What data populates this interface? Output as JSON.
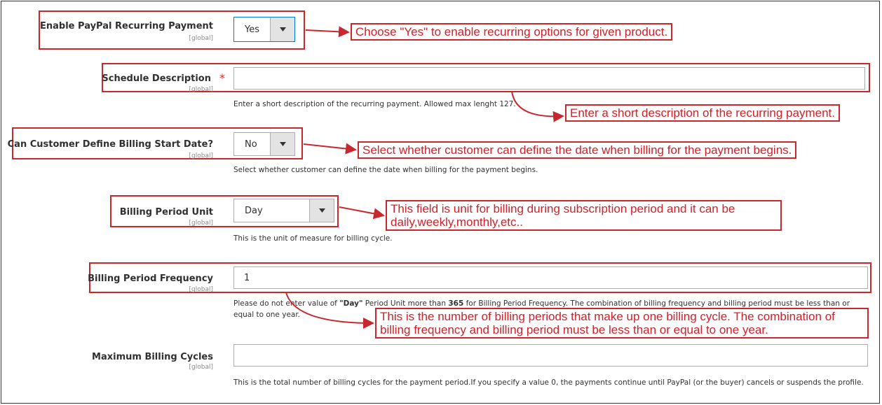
{
  "fields": {
    "enable_paypal": {
      "label": "Enable PayPal Recurring Payment",
      "scope": "[global]",
      "value": "Yes"
    },
    "schedule_description": {
      "label": "Schedule Description",
      "required_mark": "*",
      "scope": "[global]",
      "value": "",
      "note": "Enter a short description of the recurring payment. Allowed max lenght 127."
    },
    "billing_start_date": {
      "label": "Can Customer Define Billing Start Date?",
      "scope": "[global]",
      "value": "No",
      "note": "Select whether customer can define the date when billing for the payment begins."
    },
    "billing_period_unit": {
      "label": "Billing Period Unit",
      "scope": "[global]",
      "value": "Day",
      "note": "This is the unit of measure for billing cycle."
    },
    "billing_period_frequency": {
      "label": "Billing Period Frequency",
      "scope": "[global]",
      "value": "1",
      "note_part1": "Please do not enter value of ",
      "note_bold1": "\"Day\"",
      "note_part2": " Period Unit more than ",
      "note_bold2": "365",
      "note_part3": " for Billing Period Frequency. The combination of billing frequency and billing period must be less than or equal to one year."
    },
    "max_billing_cycles": {
      "label": "Maximum Billing Cycles",
      "scope": "[global]",
      "value": "",
      "note": "This is the total number of billing cycles for the payment period.If you specify a value 0, the payments continue until PayPal (or the buyer) cancels or suspends the profile."
    }
  },
  "callouts": {
    "enable": "Choose \"Yes\" to enable recurring options for given product.",
    "description": "Enter a short description of the recurring payment.",
    "start_date": "Select whether customer can define the date when billing for the payment begins.",
    "unit": "This field is unit for billing during subscription period and it can be daily,weekly,monthly,etc..",
    "frequency": "This is the number of billing periods that make up one billing cycle. The combination of billing frequency and billing period must be less than or equal to one year."
  },
  "icons": {
    "dropdown": "chevron-down-icon"
  },
  "colors": {
    "annotation": "#c8272d",
    "required": "#e22626",
    "focus_border": "#007bdb"
  }
}
